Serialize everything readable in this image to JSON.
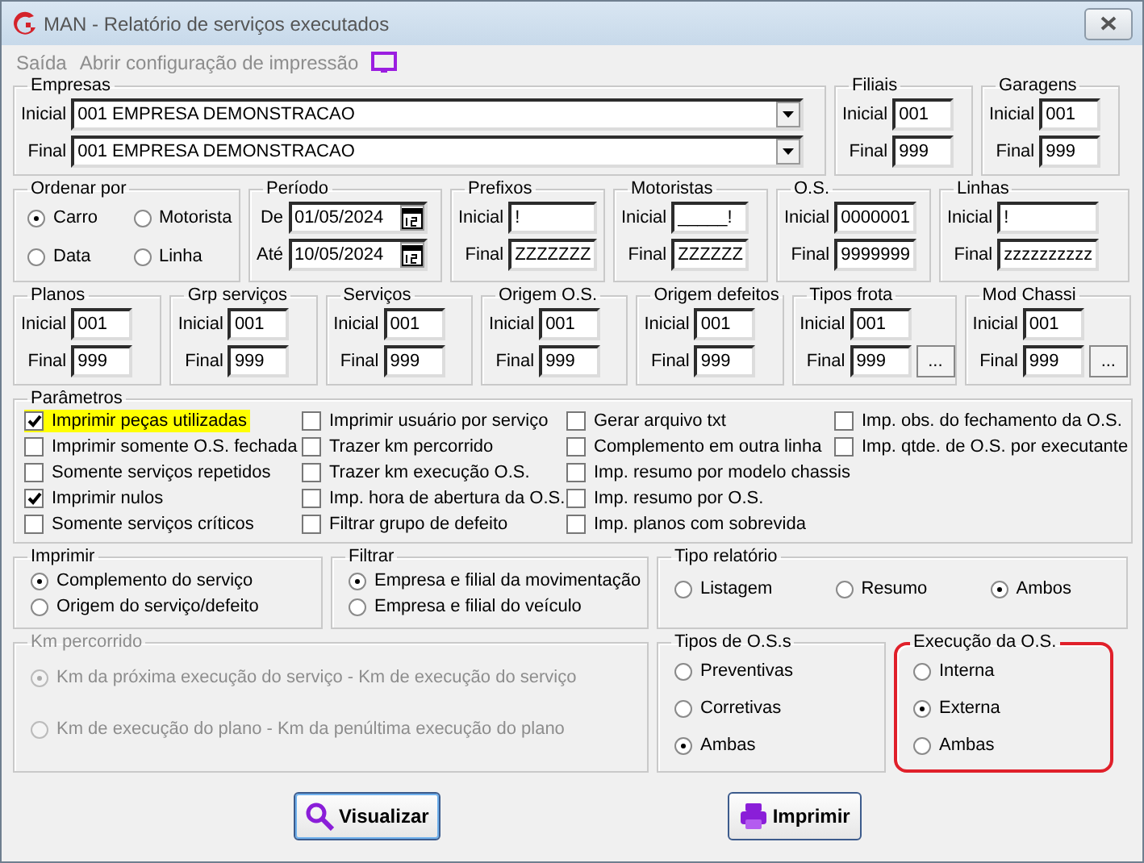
{
  "window": {
    "title": "MAN - Relatório de serviços executados"
  },
  "menu": [
    {
      "label": "Saída",
      "disabled": true
    },
    {
      "label": "Abrir configuração de impressão",
      "disabled": true
    }
  ],
  "empresas": {
    "title": "Empresas",
    "fields": [
      {
        "label": "Inicial",
        "value": "001 EMPRESA DEMONSTRACAO"
      },
      {
        "label": "Final",
        "value": "001 EMPRESA DEMONSTRACAO"
      }
    ]
  },
  "filiais": {
    "title": "Filiais",
    "fields": [
      {
        "label": "Inicial",
        "value": "001"
      },
      {
        "label": "Final",
        "value": "999"
      }
    ]
  },
  "garagens": {
    "title": "Garagens",
    "fields": [
      {
        "label": "Inicial",
        "value": "001"
      },
      {
        "label": "Final",
        "value": "999"
      }
    ]
  },
  "ordenar_por": {
    "title": "Ordenar por",
    "options": [
      {
        "label": "Carro",
        "selected": true
      },
      {
        "label": "Motorista",
        "selected": false
      },
      {
        "label": "Data",
        "selected": false
      },
      {
        "label": "Linha",
        "selected": false
      }
    ]
  },
  "periodo": {
    "title": "Período",
    "fields": [
      {
        "label": "De",
        "value": "01/05/2024"
      },
      {
        "label": "Até",
        "value": "10/05/2024"
      }
    ]
  },
  "filters_row_1": [
    {
      "title": "Prefixos",
      "fields": [
        {
          "label": "Inicial",
          "value": "!"
        },
        {
          "label": "Final",
          "value": "ZZZZZZZ"
        }
      ]
    },
    {
      "title": "Motoristas",
      "fields": [
        {
          "label": "Inicial",
          "value": "_____!"
        },
        {
          "label": "Final",
          "value": "ZZZZZZ"
        }
      ]
    },
    {
      "title": "O.S.",
      "fields": [
        {
          "label": "Inicial",
          "value": "0000001"
        },
        {
          "label": "Final",
          "value": "9999999"
        }
      ]
    },
    {
      "title": "Linhas",
      "fields": [
        {
          "label": "Inicial",
          "value": "!"
        },
        {
          "label": "Final",
          "value": "zzzzzzzzzz"
        }
      ]
    }
  ],
  "filters_row_2": [
    {
      "title": "Planos",
      "fields": [
        {
          "label": "Inicial",
          "value": "001"
        },
        {
          "label": "Final",
          "value": "999"
        }
      ]
    },
    {
      "title": "Grp serviços",
      "fields": [
        {
          "label": "Inicial",
          "value": "001"
        },
        {
          "label": "Final",
          "value": "999"
        }
      ]
    },
    {
      "title": "Serviços",
      "fields": [
        {
          "label": "Inicial",
          "value": "001"
        },
        {
          "label": "Final",
          "value": "999"
        }
      ]
    },
    {
      "title": "Origem O.S.",
      "fields": [
        {
          "label": "Inicial",
          "value": "001"
        },
        {
          "label": "Final",
          "value": "999"
        }
      ]
    },
    {
      "title": "Origem defeitos",
      "fields": [
        {
          "label": "Inicial",
          "value": "001"
        },
        {
          "label": "Final",
          "value": "999"
        }
      ]
    },
    {
      "title": "Tipos frota",
      "fields": [
        {
          "label": "Inicial",
          "value": "001"
        },
        {
          "label": "Final",
          "value": "999"
        }
      ],
      "button": "..."
    },
    {
      "title": "Mod Chassi",
      "fields": [
        {
          "label": "Inicial",
          "value": "001"
        },
        {
          "label": "Final",
          "value": "999"
        }
      ],
      "button": "..."
    }
  ],
  "parametros": {
    "title": "Parâmetros",
    "columns": [
      [
        {
          "label": "Imprimir peças utilizadas",
          "checked": true,
          "highlighted": true
        },
        {
          "label": "Imprimir somente O.S. fechada",
          "checked": false,
          "highlighted": false
        },
        {
          "label": "Somente serviços repetidos",
          "checked": false,
          "highlighted": false
        },
        {
          "label": "Imprimir nulos",
          "checked": true,
          "highlighted": false
        },
        {
          "label": "Somente serviços críticos",
          "checked": false,
          "highlighted": false
        }
      ],
      [
        {
          "label": "Imprimir usuário por serviço",
          "checked": false,
          "highlighted": false
        },
        {
          "label": "Trazer km percorrido",
          "checked": false,
          "highlighted": false
        },
        {
          "label": "Trazer km execução O.S.",
          "checked": false,
          "highlighted": false
        },
        {
          "label": "Imp. hora de abertura da O.S.",
          "checked": false,
          "highlighted": false
        },
        {
          "label": "Filtrar grupo de defeito",
          "checked": false,
          "highlighted": false
        }
      ],
      [
        {
          "label": "Gerar arquivo txt",
          "checked": false,
          "highlighted": false
        },
        {
          "label": "Complemento em outra linha",
          "checked": false,
          "highlighted": false
        },
        {
          "label": "Imp. resumo por modelo chassis",
          "checked": false,
          "highlighted": false
        },
        {
          "label": "Imp. resumo por O.S.",
          "checked": false,
          "highlighted": false
        },
        {
          "label": "Imp. planos com sobrevida",
          "checked": false,
          "highlighted": false
        }
      ],
      [
        {
          "label": "Imp. obs. do fechamento da O.S.",
          "checked": false,
          "highlighted": false
        },
        {
          "label": "Imp. qtde. de O.S. por executante",
          "checked": false,
          "highlighted": false
        }
      ]
    ]
  },
  "imprimir": {
    "title": "Imprimir",
    "options": [
      {
        "label": "Complemento do serviço",
        "selected": true
      },
      {
        "label": "Origem do serviço/defeito",
        "selected": false
      }
    ]
  },
  "filtrar": {
    "title": "Filtrar",
    "options": [
      {
        "label": "Empresa e filial da movimentação",
        "selected": true
      },
      {
        "label": "Empresa e filial do veículo",
        "selected": false
      }
    ]
  },
  "tipo_relatorio": {
    "title": "Tipo relatório",
    "options": [
      {
        "label": "Listagem",
        "selected": false
      },
      {
        "label": "Resumo",
        "selected": false
      },
      {
        "label": "Ambos",
        "selected": true
      }
    ]
  },
  "km_percorrido": {
    "title": "Km percorrido",
    "disabled": true,
    "options": [
      {
        "label": "Km da próxima execução do serviço - Km de execução do serviço",
        "selected": true
      },
      {
        "label": "Km de execução do plano - Km da penúltima execução do plano",
        "selected": false
      }
    ]
  },
  "tipos_os": {
    "title": "Tipos de O.S.s",
    "options": [
      {
        "label": "Preventivas",
        "selected": false
      },
      {
        "label": "Corretivas",
        "selected": false
      },
      {
        "label": "Ambas",
        "selected": true
      }
    ]
  },
  "execucao_os": {
    "title": "Execução da O.S.",
    "highlighted": true,
    "options": [
      {
        "label": "Interna",
        "selected": false
      },
      {
        "label": "Externa",
        "selected": true
      },
      {
        "label": "Ambas",
        "selected": false
      }
    ]
  },
  "buttons": [
    {
      "label": "Visualizar",
      "kind": "preview",
      "focused": true
    },
    {
      "label": "Imprimir",
      "kind": "print",
      "focused": false
    }
  ]
}
